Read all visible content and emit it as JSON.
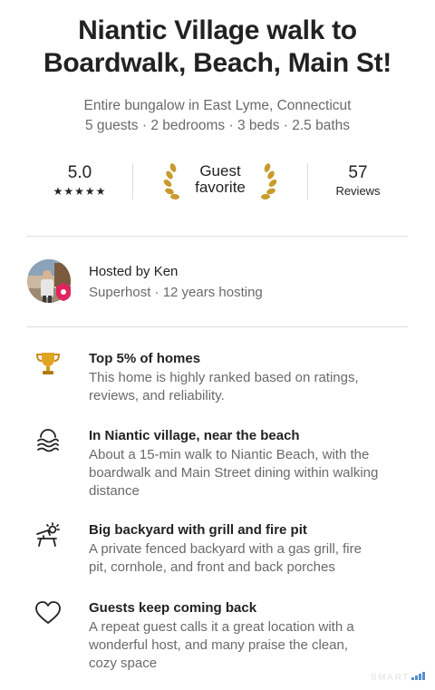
{
  "listing": {
    "title_line1": "Niantic Village walk to",
    "title_line2": "Boardwalk, Beach, Main St!",
    "type_line": "Entire bungalow in East Lyme, Connecticut",
    "details_line": "5 guests · 2 bedrooms · 3 beds · 2.5 baths"
  },
  "stats": {
    "rating": "5.0",
    "stars": "★★★★★",
    "star_count": 5,
    "guest_favorite_line1": "Guest",
    "guest_favorite_line2": "favorite",
    "reviews_count": "57",
    "reviews_label": "Reviews"
  },
  "host": {
    "title": "Hosted by Ken",
    "subtitle": "Superhost · 12 years hosting",
    "badge_color": "#e0245e"
  },
  "highlights": [
    {
      "icon": "trophy-icon",
      "title": "Top 5% of homes",
      "description": "This home is highly ranked based on ratings, reviews, and reliability."
    },
    {
      "icon": "beach-waves-icon",
      "title": "In Niantic village, near the beach",
      "description": "About a 15-min walk to Niantic Beach, with the boardwalk and Main Street dining within walking distance"
    },
    {
      "icon": "backyard-sun-icon",
      "title": "Big backyard with grill and fire pit",
      "description": "A private fenced backyard with a gas grill, fire pit, cornhole, and front and back porches"
    },
    {
      "icon": "heart-icon",
      "title": "Guests keep coming back",
      "description": "A repeat guest calls it a great location with a wonderful host, and many praise the clean, cozy space"
    }
  ],
  "watermark": "SMART"
}
